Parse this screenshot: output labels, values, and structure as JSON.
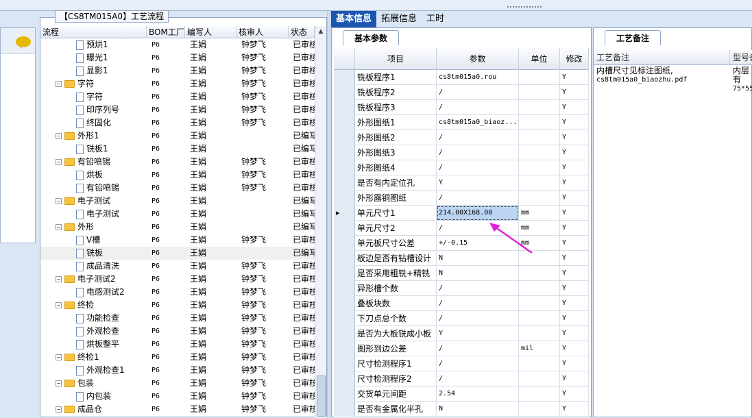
{
  "tree": {
    "title": "【CS8TM015A0】工艺流程",
    "columns": [
      "流程",
      "BOM工厂",
      "编写人",
      "核审人",
      "状态"
    ],
    "rows": [
      {
        "name": "预烘1",
        "level": 2,
        "type": "doc",
        "factory": "P6",
        "writer": "王娟",
        "reviewer": "钟梦飞",
        "status": "已审核"
      },
      {
        "name": "曝光1",
        "level": 2,
        "type": "doc",
        "factory": "P6",
        "writer": "王娟",
        "reviewer": "钟梦飞",
        "status": "已审核"
      },
      {
        "name": "显影1",
        "level": 2,
        "type": "doc",
        "factory": "P6",
        "writer": "王娟",
        "reviewer": "钟梦飞",
        "status": "已审核"
      },
      {
        "name": "字符",
        "level": 1,
        "type": "folder",
        "factory": "P6",
        "writer": "王娟",
        "reviewer": "钟梦飞",
        "status": "已审核"
      },
      {
        "name": "字符",
        "level": 2,
        "type": "doc",
        "factory": "P6",
        "writer": "王娟",
        "reviewer": "钟梦飞",
        "status": "已审核"
      },
      {
        "name": "印序列号",
        "level": 2,
        "type": "doc",
        "factory": "P6",
        "writer": "王娟",
        "reviewer": "钟梦飞",
        "status": "已审核"
      },
      {
        "name": "终固化",
        "level": 2,
        "type": "doc",
        "factory": "P6",
        "writer": "王娟",
        "reviewer": "钟梦飞",
        "status": "已审核"
      },
      {
        "name": "外形1",
        "level": 1,
        "type": "folder",
        "factory": "P6",
        "writer": "王娟",
        "reviewer": "",
        "status": "已编写"
      },
      {
        "name": "铣板1",
        "level": 2,
        "type": "doc",
        "factory": "P6",
        "writer": "王娟",
        "reviewer": "",
        "status": "已编写"
      },
      {
        "name": "有铅喷锡",
        "level": 1,
        "type": "folder",
        "factory": "P6",
        "writer": "王娟",
        "reviewer": "钟梦飞",
        "status": "已审核"
      },
      {
        "name": "烘板",
        "level": 2,
        "type": "doc",
        "factory": "P6",
        "writer": "王娟",
        "reviewer": "钟梦飞",
        "status": "已审核"
      },
      {
        "name": "有铅喷锡",
        "level": 2,
        "type": "doc",
        "factory": "P6",
        "writer": "王娟",
        "reviewer": "钟梦飞",
        "status": "已审核"
      },
      {
        "name": "电子测试",
        "level": 1,
        "type": "folder",
        "factory": "P6",
        "writer": "王娟",
        "reviewer": "",
        "status": "已编写"
      },
      {
        "name": "电子测试",
        "level": 2,
        "type": "doc",
        "factory": "P6",
        "writer": "王娟",
        "reviewer": "",
        "status": "已编写"
      },
      {
        "name": "外形",
        "level": 1,
        "type": "folder",
        "factory": "P6",
        "writer": "王娟",
        "reviewer": "",
        "status": "已编写"
      },
      {
        "name": "V槽",
        "level": 2,
        "type": "doc",
        "factory": "P6",
        "writer": "王娟",
        "reviewer": "钟梦飞",
        "status": "已审核"
      },
      {
        "name": "铣板",
        "level": 2,
        "type": "doc",
        "factory": "P6",
        "writer": "王娟",
        "reviewer": "",
        "status": "已编写",
        "selected": true
      },
      {
        "name": "成品清洗",
        "level": 2,
        "type": "doc",
        "factory": "P6",
        "writer": "王娟",
        "reviewer": "钟梦飞",
        "status": "已审核"
      },
      {
        "name": "电子测试2",
        "level": 1,
        "type": "folder",
        "factory": "P6",
        "writer": "王娟",
        "reviewer": "钟梦飞",
        "status": "已审核"
      },
      {
        "name": "电感测试2",
        "level": 2,
        "type": "doc",
        "factory": "P6",
        "writer": "王娟",
        "reviewer": "钟梦飞",
        "status": "已审核"
      },
      {
        "name": "终检",
        "level": 1,
        "type": "folder",
        "factory": "P6",
        "writer": "王娟",
        "reviewer": "钟梦飞",
        "status": "已审核"
      },
      {
        "name": "功能检查",
        "level": 2,
        "type": "doc",
        "factory": "P6",
        "writer": "王娟",
        "reviewer": "钟梦飞",
        "status": "已审核"
      },
      {
        "name": "外观检查",
        "level": 2,
        "type": "doc",
        "factory": "P6",
        "writer": "王娟",
        "reviewer": "钟梦飞",
        "status": "已审核"
      },
      {
        "name": "烘板整平",
        "level": 2,
        "type": "doc",
        "factory": "P6",
        "writer": "王娟",
        "reviewer": "钟梦飞",
        "status": "已审核"
      },
      {
        "name": "终检1",
        "level": 1,
        "type": "folder",
        "factory": "P6",
        "writer": "王娟",
        "reviewer": "钟梦飞",
        "status": "已审核"
      },
      {
        "name": "外观检查1",
        "level": 2,
        "type": "doc",
        "factory": "P6",
        "writer": "王娟",
        "reviewer": "钟梦飞",
        "status": "已审核"
      },
      {
        "name": "包装",
        "level": 1,
        "type": "folder",
        "factory": "P6",
        "writer": "王娟",
        "reviewer": "钟梦飞",
        "status": "已审核"
      },
      {
        "name": "内包装",
        "level": 2,
        "type": "doc",
        "factory": "P6",
        "writer": "王娟",
        "reviewer": "钟梦飞",
        "status": "已审核"
      },
      {
        "name": "成品仓",
        "level": 1,
        "type": "folder",
        "factory": "P6",
        "writer": "王娟",
        "reviewer": "钟梦飞",
        "status": "已审核"
      }
    ]
  },
  "tabs": [
    "基本信息",
    "拓展信息",
    "工时"
  ],
  "active_tab": 0,
  "params": {
    "subtab": "基本参数",
    "columns": [
      "项目",
      "参数",
      "单位",
      "修改"
    ],
    "rows": [
      {
        "item": "铣板程序1",
        "value": "cs8tm015a0.rou",
        "unit": "",
        "mod": "Y"
      },
      {
        "item": "铣板程序2",
        "value": "/",
        "unit": "",
        "mod": "Y"
      },
      {
        "item": "铣板程序3",
        "value": "/",
        "unit": "",
        "mod": "Y"
      },
      {
        "item": "外形图纸1",
        "value": "cs8tm015a0_biaoz...",
        "unit": "",
        "mod": "Y"
      },
      {
        "item": "外形图纸2",
        "value": "/",
        "unit": "",
        "mod": "Y"
      },
      {
        "item": "外形图纸3",
        "value": "/",
        "unit": "",
        "mod": "Y"
      },
      {
        "item": "外形图纸4",
        "value": "/",
        "unit": "",
        "mod": "Y"
      },
      {
        "item": "是否有内定位孔",
        "value": "Y",
        "unit": "",
        "mod": "Y"
      },
      {
        "item": "外形露铜图纸",
        "value": "/",
        "unit": "",
        "mod": "Y"
      },
      {
        "item": "单元尺寸1",
        "value": "214.00X168.00",
        "unit": "mm",
        "mod": "Y",
        "current": true
      },
      {
        "item": "单元尺寸2",
        "value": "/",
        "unit": "mm",
        "mod": "Y"
      },
      {
        "item": "单元板尺寸公差",
        "value": "+/-0.15",
        "unit": "mm",
        "mod": "Y"
      },
      {
        "item": "板边是否有钻槽设计",
        "value": "N",
        "unit": "",
        "mod": "Y"
      },
      {
        "item": "是否采用粗铣+精铣",
        "value": "N",
        "unit": "",
        "mod": "Y"
      },
      {
        "item": "异形槽个数",
        "value": "/",
        "unit": "",
        "mod": "Y"
      },
      {
        "item": "叠板块数",
        "value": "/",
        "unit": "",
        "mod": "Y"
      },
      {
        "item": "下刀点总个数",
        "value": "/",
        "unit": "",
        "mod": "Y"
      },
      {
        "item": "是否为大板铣成小板",
        "value": "Y",
        "unit": "",
        "mod": "Y"
      },
      {
        "item": "图形到边公差",
        "value": "/",
        "unit": "mil",
        "mod": "Y"
      },
      {
        "item": "尺寸检测程序1",
        "value": "/",
        "unit": "",
        "mod": "Y"
      },
      {
        "item": "尺寸检测程序2",
        "value": "/",
        "unit": "",
        "mod": "Y"
      },
      {
        "item": "交货单元间距",
        "value": "2.54",
        "unit": "",
        "mod": "Y"
      },
      {
        "item": "是否有金属化半孔",
        "value": "N",
        "unit": "",
        "mod": "Y"
      }
    ]
  },
  "notes": {
    "subtab": "工艺备注",
    "columns": [
      "工艺备注",
      "型号备"
    ],
    "note": "内槽尺寸见标注图纸,",
    "note2": "cs8tm015a0_biaozhu.pdf",
    "model_note": "内层有",
    "model_note2": "75*55"
  },
  "colors": {
    "accent": "#1b56b0",
    "arrow": "#e020d0",
    "selected_cell": "#bcd5f3"
  }
}
